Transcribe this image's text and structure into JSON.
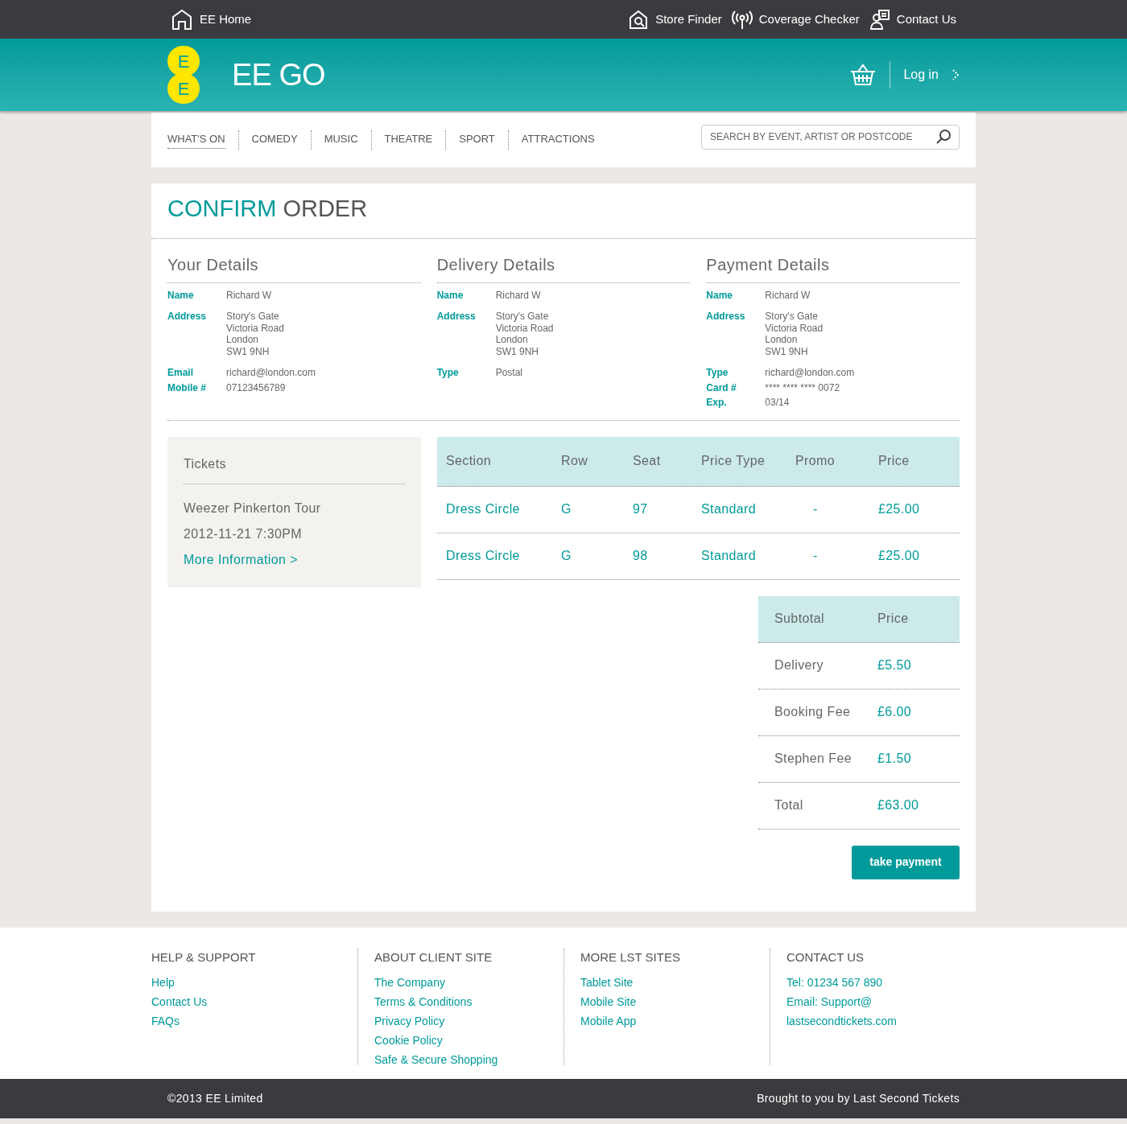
{
  "top_bar": {
    "home": "EE Home",
    "links": [
      {
        "label": "Store Finder",
        "kind": "store"
      },
      {
        "label": "Coverage Checker",
        "kind": "signal"
      },
      {
        "label": "Contact Us",
        "kind": "contact"
      }
    ]
  },
  "header": {
    "logo_letters": [
      "E",
      "E"
    ],
    "brand": "EE GO",
    "login": "Log in"
  },
  "nav": {
    "items": [
      {
        "label": "WHAT'S ON",
        "selected": true
      },
      {
        "label": "COMEDY",
        "selected": false
      },
      {
        "label": "MUSIC",
        "selected": false
      },
      {
        "label": "THEATRE",
        "selected": false
      },
      {
        "label": "SPORT",
        "selected": false
      },
      {
        "label": "ATTRACTIONS",
        "selected": false
      }
    ],
    "search": {
      "placeholder": "SEARCH BY EVENT, ARTIST OR POSTCODE"
    }
  },
  "title": {
    "highlight": "CONFIRM",
    "rest": "ORDER"
  },
  "details": [
    {
      "heading": "Your Details",
      "groups": [
        [
          {
            "label": "Name",
            "lines": [
              "Richard W"
            ]
          }
        ],
        [
          {
            "label": "Address",
            "lines": [
              "Story's Gate",
              "Victoria Road",
              "London",
              "SW1 9NH"
            ]
          }
        ],
        [
          {
            "label": "Email",
            "lines": [
              "richard@london.com"
            ]
          },
          {
            "label": "Mobile #",
            "lines": [
              "07123456789"
            ]
          }
        ]
      ]
    },
    {
      "heading": "Delivery Details",
      "groups": [
        [
          {
            "label": "Name",
            "lines": [
              "Richard W"
            ]
          }
        ],
        [
          {
            "label": "Address",
            "lines": [
              "Story's Gate",
              "Victoria Road",
              "London",
              "SW1 9NH"
            ]
          }
        ],
        [
          {
            "label": "Type",
            "lines": [
              "Postal"
            ]
          }
        ]
      ]
    },
    {
      "heading": "Payment Details",
      "groups": [
        [
          {
            "label": "Name",
            "lines": [
              "Richard W"
            ]
          }
        ],
        [
          {
            "label": "Address",
            "lines": [
              "Story's Gate",
              "Victoria Road",
              "London",
              "SW1 9NH"
            ]
          }
        ],
        [
          {
            "label": "Type",
            "lines": [
              "richard@london.com"
            ]
          },
          {
            "label": "Card #",
            "lines": [
              "**** **** **** 0072"
            ]
          },
          {
            "label": "Exp.",
            "lines": [
              "03/14"
            ]
          }
        ]
      ]
    }
  ],
  "tickets": {
    "heading": "Tickets",
    "event": "Weezer Pinkerton Tour",
    "date": "2012-11-21 7:30PM",
    "link": "More Information >"
  },
  "table": {
    "columns": [
      "Section",
      "Row",
      "Seat",
      "Price Type",
      "Promo",
      "Price"
    ],
    "rows": [
      [
        "Dress Circle",
        "G",
        "97",
        "Standard",
        "-",
        "£25.00"
      ],
      [
        "Dress Circle",
        "G",
        "98",
        "Standard",
        "-",
        "£25.00"
      ]
    ]
  },
  "summary": {
    "columns": [
      "Subtotal",
      "Price"
    ],
    "rows": [
      [
        "Delivery",
        "£5.50"
      ],
      [
        "Booking Fee",
        "£6.00"
      ],
      [
        "Stephen Fee",
        "£1.50"
      ],
      [
        "Total",
        "£63.00"
      ]
    ]
  },
  "pay_button": "take payment",
  "footer": {
    "columns": [
      {
        "heading": "HELP & SUPPORT",
        "links": [
          "Help",
          "Contact Us",
          "FAQs"
        ]
      },
      {
        "heading": "ABOUT CLIENT SITE",
        "links": [
          "The Company",
          "Terms & Conditions",
          "Privacy Policy",
          "Cookie Policy",
          "Safe & Secure Shopping"
        ]
      },
      {
        "heading": "MORE LST SITES",
        "links": [
          "Tablet Site",
          "Mobile Site",
          "Mobile App"
        ]
      },
      {
        "heading": "CONTACT US",
        "links": [
          "Tel: 01234 567 890",
          "Email: Support@",
          "lastsecondtickets.com"
        ]
      }
    ],
    "copyright": "©2013 EE Limited",
    "credit": "Brought to you by Last Second Tickets"
  }
}
